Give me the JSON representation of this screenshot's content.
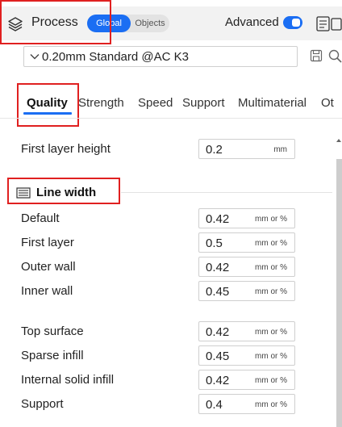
{
  "header": {
    "title": "Process",
    "mode_global": "Global",
    "mode_objects": "Objects",
    "advanced_label": "Advanced",
    "advanced_on": true
  },
  "preset": {
    "name": "0.20mm Standard @AC K3"
  },
  "tabs": [
    {
      "label": "Quality",
      "active": true
    },
    {
      "label": "Strength"
    },
    {
      "label": "Speed"
    },
    {
      "label": "Support"
    },
    {
      "label": "Multimaterial"
    },
    {
      "label": "Ot"
    }
  ],
  "settings": {
    "first_layer_height": {
      "label": "First layer height",
      "value": "0.2",
      "unit": "mm"
    },
    "line_width": {
      "title": "Line width",
      "rows": [
        {
          "label": "Default",
          "value": "0.42",
          "unit": "mm or %"
        },
        {
          "label": "First layer",
          "value": "0.5",
          "unit": "mm or %"
        },
        {
          "label": "Outer wall",
          "value": "0.42",
          "unit": "mm or %"
        },
        {
          "label": "Inner wall",
          "value": "0.45",
          "unit": "mm or %"
        },
        {
          "label": "Top surface",
          "value": "0.42",
          "unit": "mm or %"
        },
        {
          "label": "Sparse infill",
          "value": "0.45",
          "unit": "mm or %"
        },
        {
          "label": "Internal solid infill",
          "value": "0.42",
          "unit": "mm or %"
        },
        {
          "label": "Support",
          "value": "0.4",
          "unit": "mm or %"
        }
      ]
    }
  },
  "colors": {
    "accent": "#1b6ef3",
    "annotation": "#e02020"
  },
  "icons": [
    "layers-icon",
    "chevron-down-icon",
    "save-icon",
    "search-icon",
    "compare-icon",
    "line-width-icon",
    "scroll-up-icon"
  ]
}
